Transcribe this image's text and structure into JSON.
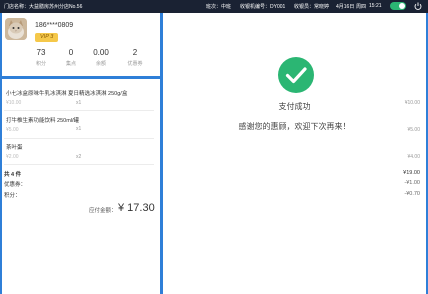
{
  "topbar": {
    "store": "门店名称：大益膳房苏州分店No.56",
    "shift": "班次：中班",
    "register": "收银机编号：DY001",
    "cashier": "收银员：常晓婷",
    "date": "4月16日",
    "week": "周四",
    "time": "15:21",
    "online_toggle": "on",
    "icons": [
      "toggle-switch",
      "power-icon"
    ]
  },
  "member": {
    "phone": "186****0809",
    "vip": "VIP 3",
    "stats": [
      {
        "value": "73",
        "label": "积分"
      },
      {
        "value": "0",
        "label": "集点"
      },
      {
        "value": "0.00",
        "label": "余额"
      },
      {
        "value": "2",
        "label": "优惠券"
      }
    ]
  },
  "products": [
    {
      "name": "小七冰盒原味牛乳冰淇淋  夏日精选冰淇淋  250g/盒",
      "price": "¥10.00",
      "qty": "x1",
      "total": "¥10.00"
    },
    {
      "name": "打牛椎生素功能饮料 250ml/罐",
      "price": "¥5.00",
      "qty": "x1",
      "total": "¥5.00"
    },
    {
      "name": "茶叶蛋",
      "price": "¥2.00",
      "qty": "x2",
      "total": "¥4.00"
    }
  ],
  "summary": {
    "count_label": "共 4 件",
    "count_value": "¥19.00",
    "discount_label": "优惠券：",
    "discount_value": "-¥1.00",
    "points_label": "积分：",
    "points_value": "-¥0.70",
    "due_label": "应付金额：",
    "due_value": "¥  17.30"
  },
  "success": {
    "title": "支付成功",
    "message": "感谢您的惠顾，欢迎下次再来！"
  },
  "colors": {
    "accent": "#2f7fd8",
    "success": "#2bb673",
    "topbar": "#1a2233",
    "vip": "#f5c84a"
  }
}
